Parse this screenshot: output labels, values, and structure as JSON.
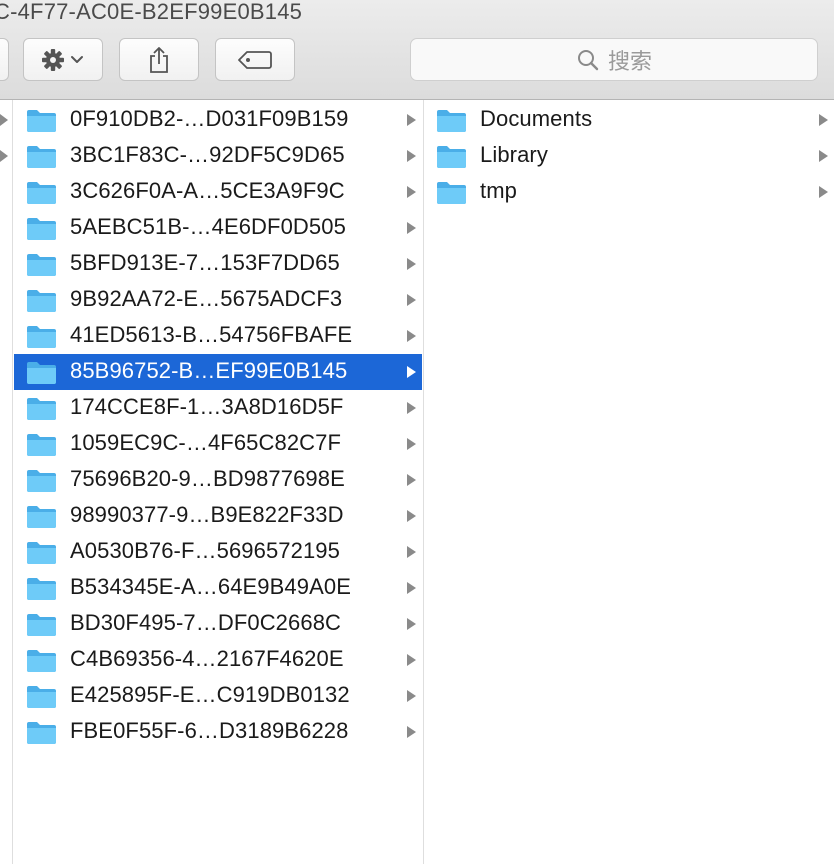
{
  "window": {
    "title": "C-4F77-AC0E-B2EF99E0B145"
  },
  "toolbar": {
    "action_icon": "gear-icon",
    "share_icon": "share-icon",
    "tag_icon": "tag-icon",
    "search_placeholder": "搜索"
  },
  "colors": {
    "selection": "#1c67d7",
    "folder": "#5ac0f6"
  },
  "column1": {
    "items": [
      {
        "label": "0F910DB2-…D031F09B159"
      },
      {
        "label": "3BC1F83C-…92DF5C9D65"
      },
      {
        "label": "3C626F0A-A…5CE3A9F9C"
      },
      {
        "label": "5AEBC51B-…4E6DF0D505"
      },
      {
        "label": "5BFD913E-7…153F7DD65"
      },
      {
        "label": "9B92AA72-E…5675ADCF3"
      },
      {
        "label": "41ED5613-B…54756FBAFE"
      },
      {
        "label": "85B96752-B…EF99E0B145",
        "selected": true
      },
      {
        "label": "174CCE8F-1…3A8D16D5F"
      },
      {
        "label": "1059EC9C-…4F65C82C7F"
      },
      {
        "label": "75696B20-9…BD9877698E"
      },
      {
        "label": "98990377-9…B9E822F33D"
      },
      {
        "label": "A0530B76-F…5696572195"
      },
      {
        "label": "B534345E-A…64E9B49A0E"
      },
      {
        "label": "BD30F495-7…DF0C2668C"
      },
      {
        "label": "C4B69356-4…2167F4620E"
      },
      {
        "label": "E425895F-E…C919DB0132"
      },
      {
        "label": "FBE0F55F-6…D3189B6228"
      }
    ]
  },
  "column2": {
    "items": [
      {
        "label": "Documents"
      },
      {
        "label": "Library"
      },
      {
        "label": "tmp"
      }
    ]
  }
}
